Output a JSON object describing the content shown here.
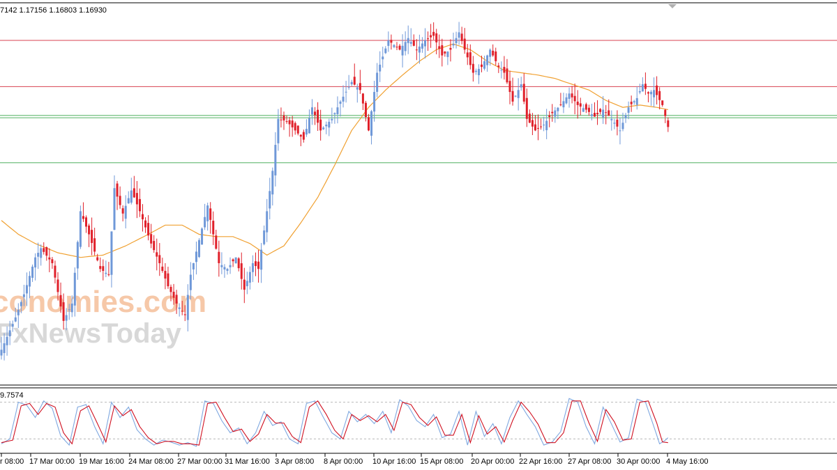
{
  "ohlc_header": "7142 1.17156 1.16803 1.16930",
  "indicator_header": "9.7574",
  "watermark": {
    "line1": "conomies.com",
    "line2": "FxNewsToday"
  },
  "colors": {
    "bull": "#6f98d8",
    "bear": "#e0202a",
    "ma": "#f0a030",
    "resistance": "#d84050",
    "support": "#50b060",
    "stoch_main": "#7fa8e0",
    "stoch_signal": "#d01020",
    "watermark1": "#f6c8a8",
    "watermark2": "#d8d8d8"
  },
  "chart_data": [
    {
      "type": "candlestick",
      "symbol": "",
      "ylim": [
        1.147,
        1.18
      ],
      "x_tick_labels": [
        "r 08:00",
        "17 Mar 00:00",
        "19 Mar 16:00",
        "24 Mar 08:00",
        "27 Mar 00:00",
        "31 Mar 16:00",
        "3 Apr 08:00",
        "8 Apr 00:00",
        "10 Apr 16:00",
        "15 Apr 08:00",
        "20 Apr 00:00",
        "22 Apr 16:00",
        "27 Apr 08:00",
        "30 Apr 00:00",
        "4 May 16:00"
      ],
      "horizontal_levels": [
        {
          "value": 1.1768,
          "kind": "resistance"
        },
        {
          "value": 1.1728,
          "kind": "resistance"
        },
        {
          "value": 1.1703,
          "kind": "support"
        },
        {
          "value": 1.1701,
          "kind": "support"
        },
        {
          "value": 1.1662,
          "kind": "support"
        }
      ],
      "close_anchors": [
        [
          0,
          1.15
        ],
        [
          5,
          1.1528
        ],
        [
          8,
          1.1548
        ],
        [
          12,
          1.158
        ],
        [
          14,
          1.1588
        ],
        [
          18,
          1.1575
        ],
        [
          22,
          1.1525
        ],
        [
          25,
          1.154
        ],
        [
          28,
          1.162
        ],
        [
          31,
          1.16
        ],
        [
          35,
          1.157
        ],
        [
          38,
          1.1565
        ],
        [
          40,
          1.164
        ],
        [
          43,
          1.1618
        ],
        [
          46,
          1.1638
        ],
        [
          49,
          1.162
        ],
        [
          53,
          1.1592
        ],
        [
          56,
          1.1575
        ],
        [
          59,
          1.1555
        ],
        [
          62,
          1.154
        ],
        [
          65,
          1.153
        ],
        [
          67,
          1.1565
        ],
        [
          70,
          1.1595
        ],
        [
          73,
          1.1625
        ],
        [
          77,
          1.1575
        ],
        [
          80,
          1.157
        ],
        [
          83,
          1.158
        ],
        [
          86,
          1.1552
        ],
        [
          89,
          1.1575
        ],
        [
          91,
          1.157
        ],
        [
          94,
          1.162
        ],
        [
          96,
          1.1655
        ],
        [
          98,
          1.17
        ],
        [
          101,
          1.1698
        ],
        [
          104,
          1.169
        ],
        [
          107,
          1.1682
        ],
        [
          110,
          1.171
        ],
        [
          113,
          1.169
        ],
        [
          117,
          1.17
        ],
        [
          120,
          1.1715
        ],
        [
          124,
          1.1732
        ],
        [
          127,
          1.1725
        ],
        [
          130,
          1.169
        ],
        [
          133,
          1.174
        ],
        [
          137,
          1.1768
        ],
        [
          141,
          1.176
        ],
        [
          144,
          1.177
        ],
        [
          147,
          1.176
        ],
        [
          150,
          1.1768
        ],
        [
          153,
          1.1772
        ],
        [
          156,
          1.1755
        ],
        [
          159,
          1.176
        ],
        [
          162,
          1.1775
        ],
        [
          164,
          1.176
        ],
        [
          167,
          1.174
        ],
        [
          170,
          1.1745
        ],
        [
          173,
          1.176
        ],
        [
          176,
          1.1745
        ],
        [
          178,
          1.174
        ],
        [
          181,
          1.1715
        ],
        [
          184,
          1.173
        ],
        [
          186,
          1.17
        ],
        [
          189,
          1.169
        ],
        [
          192,
          1.1695
        ],
        [
          195,
          1.1705
        ],
        [
          198,
          1.1712
        ],
        [
          201,
          1.1722
        ],
        [
          204,
          1.1712
        ],
        [
          207,
          1.1708
        ],
        [
          210,
          1.1702
        ],
        [
          213,
          1.1708
        ],
        [
          216,
          1.17
        ],
        [
          219,
          1.169
        ],
        [
          222,
          1.171
        ],
        [
          225,
          1.1718
        ],
        [
          227,
          1.173
        ],
        [
          229,
          1.1722
        ],
        [
          231,
          1.1725
        ],
        [
          234,
          1.1712
        ],
        [
          236,
          1.1693
        ]
      ],
      "ma_anchors": [
        [
          0,
          1.1612
        ],
        [
          6,
          1.16
        ],
        [
          12,
          1.1592
        ],
        [
          20,
          1.1584
        ],
        [
          28,
          1.158
        ],
        [
          36,
          1.1582
        ],
        [
          44,
          1.159
        ],
        [
          52,
          1.16
        ],
        [
          58,
          1.1608
        ],
        [
          64,
          1.1608
        ],
        [
          70,
          1.16
        ],
        [
          76,
          1.1598
        ],
        [
          82,
          1.1598
        ],
        [
          88,
          1.1592
        ],
        [
          94,
          1.1582
        ],
        [
          100,
          1.159
        ],
        [
          106,
          1.161
        ],
        [
          112,
          1.1632
        ],
        [
          118,
          1.166
        ],
        [
          124,
          1.169
        ],
        [
          130,
          1.171
        ],
        [
          136,
          1.1725
        ],
        [
          142,
          1.1738
        ],
        [
          148,
          1.175
        ],
        [
          154,
          1.176
        ],
        [
          160,
          1.1765
        ],
        [
          166,
          1.176
        ],
        [
          172,
          1.175
        ],
        [
          178,
          1.1742
        ],
        [
          184,
          1.174
        ],
        [
          190,
          1.1738
        ],
        [
          196,
          1.1735
        ],
        [
          202,
          1.173
        ],
        [
          208,
          1.1725
        ],
        [
          214,
          1.1716
        ],
        [
          220,
          1.171
        ],
        [
          226,
          1.1712
        ],
        [
          232,
          1.171
        ],
        [
          236,
          1.1708
        ]
      ]
    },
    {
      "type": "line",
      "name": "stochastic",
      "ylim": [
        0,
        100
      ],
      "levels": [
        80,
        20
      ],
      "main_anchors": [
        [
          0,
          12
        ],
        [
          3,
          20
        ],
        [
          6,
          80
        ],
        [
          9,
          75
        ],
        [
          12,
          55
        ],
        [
          15,
          82
        ],
        [
          18,
          70
        ],
        [
          21,
          25
        ],
        [
          24,
          10
        ],
        [
          27,
          72
        ],
        [
          30,
          76
        ],
        [
          33,
          40
        ],
        [
          36,
          12
        ],
        [
          39,
          80
        ],
        [
          42,
          55
        ],
        [
          45,
          72
        ],
        [
          48,
          35
        ],
        [
          51,
          20
        ],
        [
          54,
          10
        ],
        [
          57,
          18
        ],
        [
          60,
          15
        ],
        [
          63,
          10
        ],
        [
          66,
          14
        ],
        [
          69,
          8
        ],
        [
          72,
          82
        ],
        [
          75,
          78
        ],
        [
          78,
          50
        ],
        [
          81,
          30
        ],
        [
          84,
          38
        ],
        [
          87,
          12
        ],
        [
          90,
          30
        ],
        [
          93,
          65
        ],
        [
          96,
          42
        ],
        [
          99,
          48
        ],
        [
          102,
          20
        ],
        [
          105,
          12
        ],
        [
          108,
          78
        ],
        [
          111,
          82
        ],
        [
          114,
          55
        ],
        [
          117,
          30
        ],
        [
          120,
          20
        ],
        [
          123,
          65
        ],
        [
          126,
          48
        ],
        [
          129,
          60
        ],
        [
          132,
          45
        ],
        [
          135,
          65
        ],
        [
          138,
          30
        ],
        [
          141,
          84
        ],
        [
          144,
          74
        ],
        [
          147,
          50
        ],
        [
          150,
          40
        ],
        [
          153,
          60
        ],
        [
          156,
          22
        ],
        [
          159,
          28
        ],
        [
          162,
          65
        ],
        [
          165,
          10
        ],
        [
          168,
          65
        ],
        [
          171,
          24
        ],
        [
          174,
          45
        ],
        [
          177,
          12
        ],
        [
          180,
          55
        ],
        [
          183,
          82
        ],
        [
          186,
          60
        ],
        [
          189,
          40
        ],
        [
          192,
          10
        ],
        [
          195,
          15
        ],
        [
          198,
          32
        ],
        [
          201,
          86
        ],
        [
          204,
          80
        ],
        [
          207,
          40
        ],
        [
          210,
          12
        ],
        [
          213,
          72
        ],
        [
          216,
          44
        ],
        [
          219,
          15
        ],
        [
          222,
          22
        ],
        [
          225,
          85
        ],
        [
          228,
          80
        ],
        [
          231,
          40
        ],
        [
          233,
          12
        ],
        [
          235,
          18
        ],
        [
          236,
          22
        ]
      ],
      "signal_anchors": [
        [
          0,
          14
        ],
        [
          4,
          18
        ],
        [
          7,
          74
        ],
        [
          10,
          78
        ],
        [
          13,
          60
        ],
        [
          16,
          78
        ],
        [
          19,
          72
        ],
        [
          22,
          30
        ],
        [
          25,
          12
        ],
        [
          28,
          66
        ],
        [
          31,
          74
        ],
        [
          34,
          45
        ],
        [
          37,
          15
        ],
        [
          40,
          74
        ],
        [
          43,
          58
        ],
        [
          46,
          68
        ],
        [
          49,
          40
        ],
        [
          52,
          22
        ],
        [
          55,
          12
        ],
        [
          58,
          16
        ],
        [
          61,
          16
        ],
        [
          64,
          12
        ],
        [
          67,
          12
        ],
        [
          70,
          10
        ],
        [
          73,
          78
        ],
        [
          76,
          80
        ],
        [
          79,
          55
        ],
        [
          82,
          32
        ],
        [
          85,
          36
        ],
        [
          88,
          16
        ],
        [
          91,
          28
        ],
        [
          94,
          60
        ],
        [
          97,
          46
        ],
        [
          100,
          46
        ],
        [
          103,
          24
        ],
        [
          106,
          14
        ],
        [
          109,
          72
        ],
        [
          112,
          82
        ],
        [
          115,
          60
        ],
        [
          118,
          34
        ],
        [
          121,
          20
        ],
        [
          124,
          60
        ],
        [
          127,
          50
        ],
        [
          130,
          58
        ],
        [
          133,
          48
        ],
        [
          136,
          60
        ],
        [
          139,
          34
        ],
        [
          142,
          80
        ],
        [
          145,
          76
        ],
        [
          148,
          55
        ],
        [
          151,
          42
        ],
        [
          154,
          56
        ],
        [
          157,
          26
        ],
        [
          160,
          26
        ],
        [
          163,
          60
        ],
        [
          166,
          14
        ],
        [
          169,
          58
        ],
        [
          172,
          28
        ],
        [
          175,
          40
        ],
        [
          178,
          15
        ],
        [
          181,
          50
        ],
        [
          184,
          80
        ],
        [
          187,
          64
        ],
        [
          190,
          44
        ],
        [
          193,
          14
        ],
        [
          196,
          14
        ],
        [
          199,
          30
        ],
        [
          202,
          82
        ],
        [
          205,
          82
        ],
        [
          208,
          46
        ],
        [
          211,
          16
        ],
        [
          214,
          68
        ],
        [
          217,
          48
        ],
        [
          220,
          18
        ],
        [
          223,
          20
        ],
        [
          226,
          80
        ],
        [
          229,
          82
        ],
        [
          232,
          46
        ],
        [
          234,
          15
        ],
        [
          236,
          14
        ]
      ]
    }
  ]
}
